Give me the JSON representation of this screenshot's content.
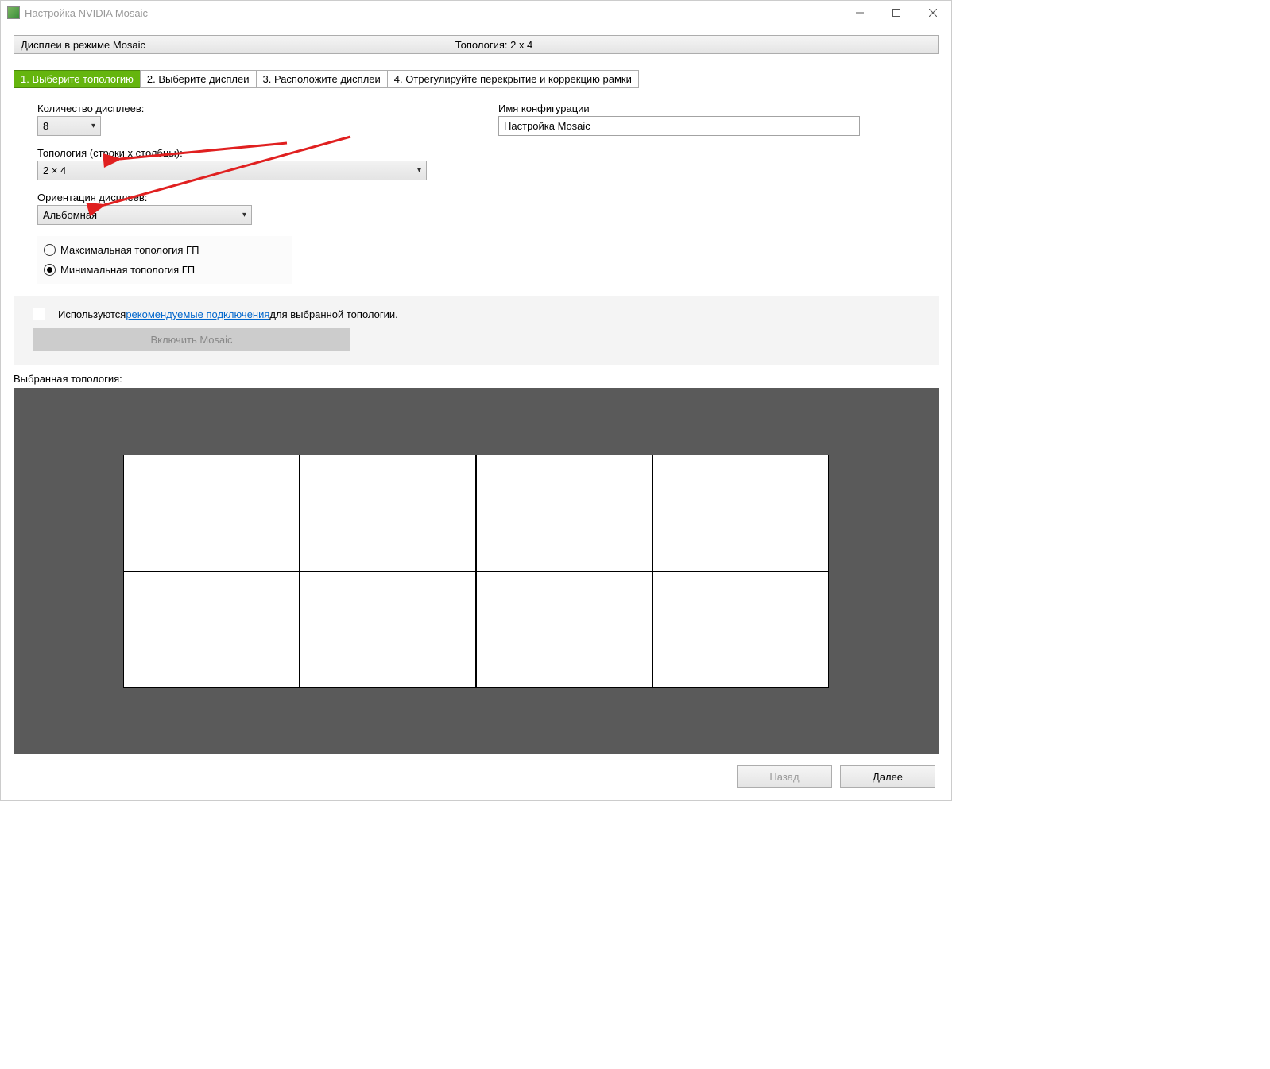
{
  "window": {
    "title": "Настройка NVIDIA Mosaic"
  },
  "header": {
    "left": "Дисплеи в режиме Mosaic",
    "center": "Топология: 2 x 4"
  },
  "tabs": [
    {
      "label": "1. Выберите топологию",
      "active": true
    },
    {
      "label": "2. Выберите дисплеи",
      "active": false
    },
    {
      "label": "3. Расположите дисплеи",
      "active": false
    },
    {
      "label": "4. Отрегулируйте перекрытие и коррекцию рамки",
      "active": false
    }
  ],
  "form": {
    "displays_count_label": "Количество дисплеев:",
    "displays_count_value": "8",
    "topology_label": "Топология (строки х столбцы):",
    "topology_value": "2 × 4",
    "orientation_label": "Ориентация дисплеев:",
    "orientation_value": "Альбомная",
    "radio_max": "Максимальная топология ГП",
    "radio_min": "Минимальная топология ГП",
    "radio_selected": "min",
    "config_name_label": "Имя конфигурации",
    "config_name_value": "Настройка Mosaic"
  },
  "enable_section": {
    "prefix": "Используются ",
    "link": "рекомендуемые подключения",
    "suffix": " для выбранной топологии.",
    "button": "Включить Mosaic"
  },
  "preview_label": "Выбранная топология:",
  "topology_grid": {
    "rows": 2,
    "cols": 4
  },
  "footer": {
    "back": "Назад",
    "next": "Далее"
  }
}
